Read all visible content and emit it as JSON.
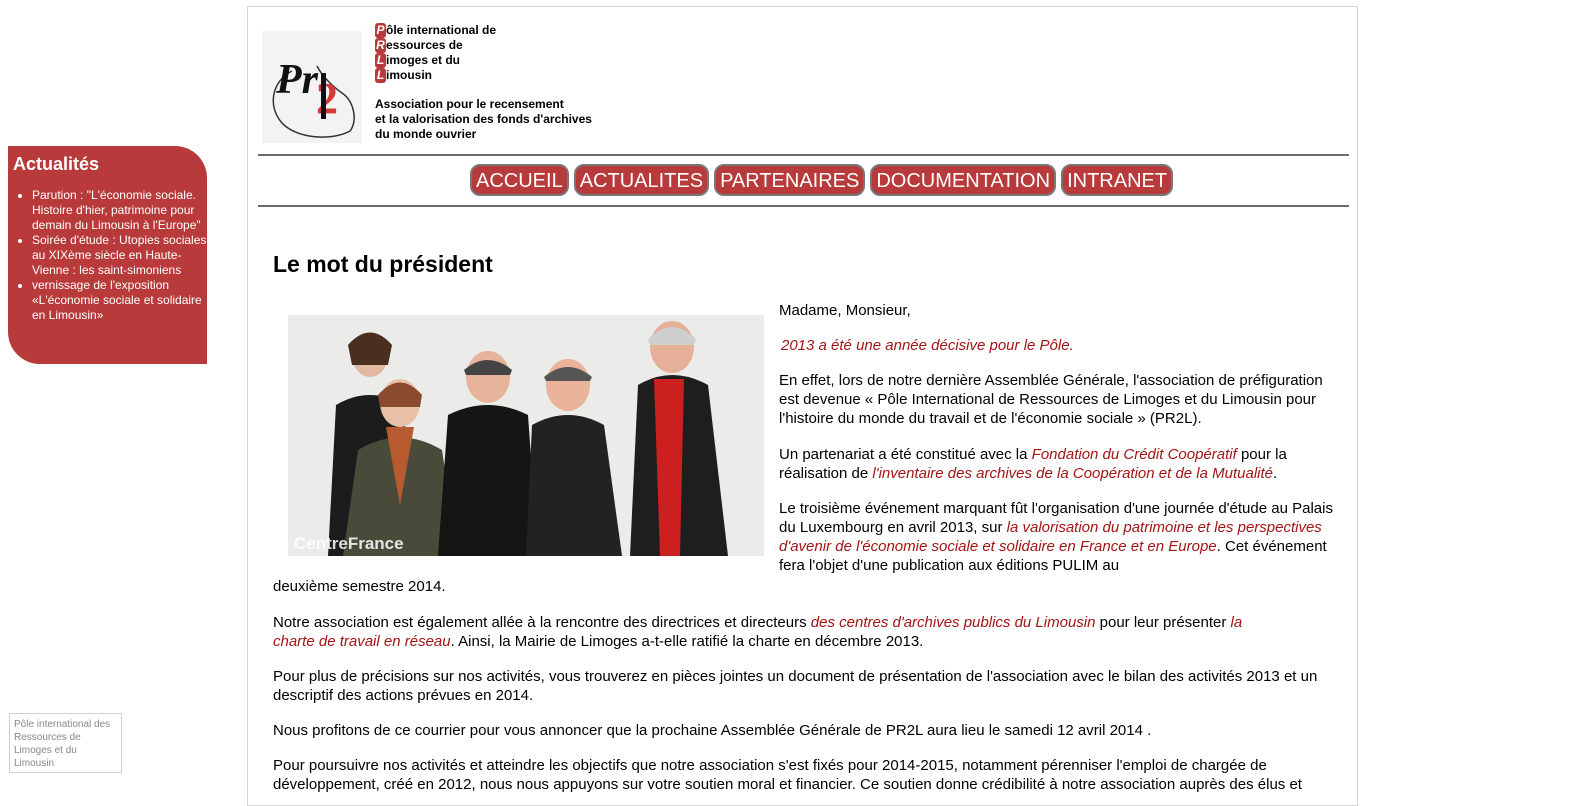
{
  "sidebar": {
    "title": "Actualités",
    "items": [
      "Parution : \"L'économie sociale. Histoire d'hier, patrimoine pour demain du Limousin à l'Europe\"",
      "Soirée d'étude : Utopies sociales au XIXème siècle en Haute-Vienne : les saint-simoniens",
      "vernissage de l'exposition «L'économie sociale et solidaire en Limousin»"
    ]
  },
  "mini_box": {
    "lines": [
      "Pôle international des",
      "Ressources de",
      "Limoges et du",
      "Limousin"
    ]
  },
  "header": {
    "logo_text": "Pr2L",
    "pole_lines": [
      {
        "cap": "P",
        "rest": "ôle international de"
      },
      {
        "cap": "R",
        "rest": "essources de"
      },
      {
        "cap": "L",
        "rest": "imoges et du"
      },
      {
        "cap": "L",
        "rest": "imousin"
      }
    ],
    "assoc_lines": [
      "Association pour le recensement",
      "et la valorisation des fonds d'archives",
      "du monde ouvrier"
    ]
  },
  "nav": [
    "ACCUEIL",
    "ACTUALITES",
    "PARTENAIRES",
    "DOCUMENTATION",
    "INTRANET"
  ],
  "content": {
    "title": "Le mot du président",
    "photo_watermark": "CentreFrance",
    "greeting": "Madame, Monsieur,",
    "p_highlight": "2013 a été une année décisive pour le Pôle.",
    "p1": "En effet, lors de notre dernière Assemblée Générale, l'association de préfiguration est devenue « Pôle International de Ressources de Limoges et du Limousin pour l'histoire du monde du travail et de l'économie sociale » (PR2L).",
    "p2_a": "Un partenariat a été constitué avec la ",
    "p2_link1": "Fondation du Crédit Coopératif",
    "p2_b": " pour la réalisation de ",
    "p2_link2": "l'inventaire des archives de la Coopération et de la Mutualité",
    "p2_c": ".",
    "p3_a": "Le troisième événement marquant fût l'organisation d'une journée d'étude au Palais du Luxembourg en avril 2013, sur ",
    "p3_link": "la valorisation du patrimoine et les perspectives d'avenir de l'économie sociale et solidaire en France et en Europe",
    "p3_b": ". Cet événement fera l'objet d'une publication aux éditions PULIM au",
    "p3_c": "deuxième semestre 2014.",
    "p4_a": "Notre association est également allée à la rencontre des directrices et directeurs ",
    "p4_link1": "des centres d'archives publics du Limousin",
    "p4_b": " pour leur présenter ",
    "p4_link2a": "la",
    "p4_link2b": "charte de travail en réseau",
    "p4_c": ". Ainsi, la Mairie de Limoges a-t-elle ratifié la charte en décembre 2013.",
    "p5": "Pour plus de précisions sur nos activités, vous trouverez en pièces jointes un document de présentation de l'association avec le bilan des activités 2013 et un descriptif des actions prévues en 2014.",
    "p6": "Nous profitons de ce courrier pour vous annoncer que la prochaine Assemblée Générale de PR2L aura lieu le samedi 12 avril 2014 .",
    "p7": "Pour poursuivre nos activités et atteindre les objectifs que notre association s'est fixés pour 2014-2015, notamment pérenniser l'emploi de chargée de développement, créé en 2012, nous nous appuyons sur votre soutien moral et financier. Ce soutien donne crédibilité à notre association auprès des élus et"
  },
  "colors": {
    "accent": "#b83a3a",
    "link": "#a31515",
    "rule": "#6c6c6c"
  }
}
